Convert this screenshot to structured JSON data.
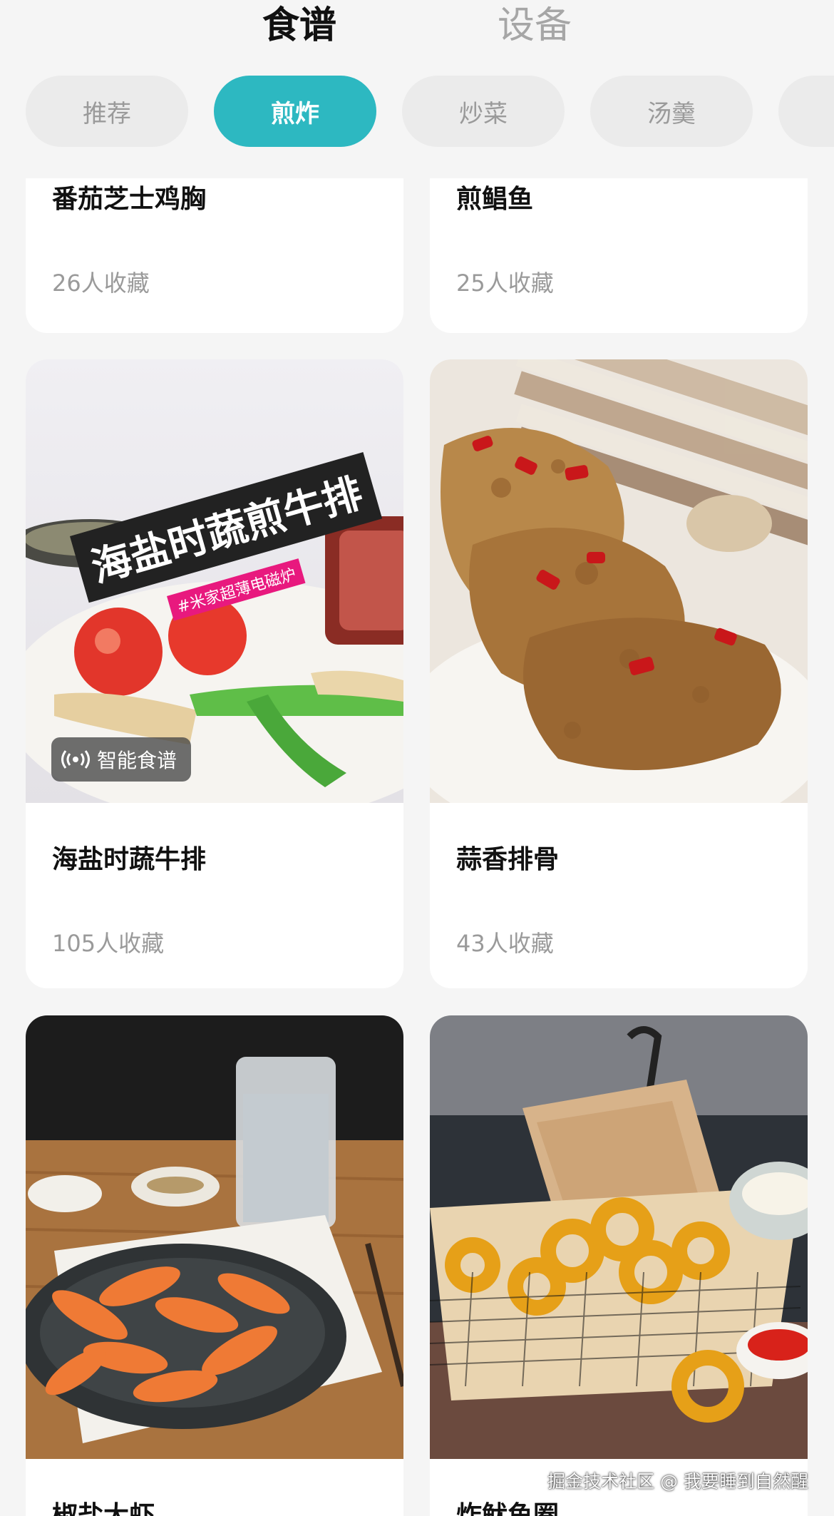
{
  "header": {
    "tabs": [
      {
        "label": "食谱",
        "active": true
      },
      {
        "label": "设备",
        "active": false
      }
    ]
  },
  "categories": [
    {
      "label": "推荐",
      "active": false
    },
    {
      "label": "煎炸",
      "active": true
    },
    {
      "label": "炒菜",
      "active": false
    },
    {
      "label": "汤羹",
      "active": false
    }
  ],
  "recipes": [
    {
      "title": "番茄芝士鸡胸",
      "favorites": "26人收藏"
    },
    {
      "title": "煎鲳鱼",
      "favorites": "25人收藏"
    },
    {
      "title": "海盐时蔬牛排",
      "favorites": "105人收藏",
      "badge": "智能食谱",
      "image_text": "海盐时蔬煎牛排",
      "image_subtext": "#米家超薄电磁炉"
    },
    {
      "title": "蒜香排骨",
      "favorites": "43人收藏"
    },
    {
      "title": "椒盐大虾",
      "favorites": ""
    },
    {
      "title": "炸鱿鱼圈",
      "favorites": ""
    }
  ],
  "watermark": "掘金技术社区 @ 我要睡到自然醒",
  "colors": {
    "accent": "#2db8c1",
    "background": "#f5f5f5",
    "muted_text": "#9a9a9a"
  }
}
